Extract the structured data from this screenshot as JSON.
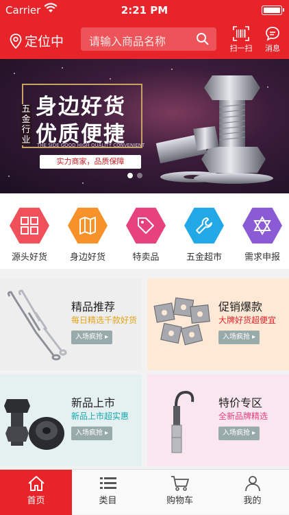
{
  "status": {
    "carrier": "Carrier",
    "time": "2:21 PM"
  },
  "navbar": {
    "location": "定位中",
    "search_placeholder": "请输入商品名称",
    "scan_label": "扫一扫",
    "message_label": "消息"
  },
  "banner": {
    "vertical_text": "五金行业",
    "line1": "身边好货",
    "line2": "优质便捷",
    "english": "THE SIDE GOOD HIGH QUALITY CONVENIENT",
    "slogan": "实力商家，品质保障"
  },
  "categories": [
    {
      "label": "源头好货",
      "icon": "grid-icon",
      "color": "#f0505a"
    },
    {
      "label": "身边好货",
      "icon": "map-icon",
      "color": "#f7922b"
    },
    {
      "label": "特卖品",
      "icon": "tag-icon",
      "color": "#e8427e"
    },
    {
      "label": "五金超市",
      "icon": "wrench-icon",
      "color": "#22a8e6"
    },
    {
      "label": "需求申报",
      "icon": "star-of-david-icon",
      "color": "#8b5bd6"
    }
  ],
  "promos": [
    {
      "title": "精品推荐",
      "subtitle": "每日精选千款好货",
      "button": "入场疯抢",
      "subtitle_color": "#e6a21b",
      "bg": "#eeeeee"
    },
    {
      "title": "促销爆款",
      "subtitle": "大牌好货超便宜",
      "button": "入场疯抢",
      "subtitle_color": "#e8242b",
      "bg": "#fde9d6"
    },
    {
      "title": "新品上市",
      "subtitle": "新品上市超实惠",
      "button": "入场疯抢",
      "subtitle_color": "#1aa6b0",
      "bg": "#e4f1f0"
    },
    {
      "title": "特价专区",
      "subtitle": "全新品牌精选",
      "button": "入场疯抢",
      "subtitle_color": "#e8427e",
      "bg": "#f9e6ee"
    }
  ],
  "tabs": [
    {
      "label": "首页",
      "icon": "home-icon",
      "active": true
    },
    {
      "label": "类目",
      "icon": "list-icon",
      "active": false
    },
    {
      "label": "购物车",
      "icon": "cart-icon",
      "active": false
    },
    {
      "label": "我的",
      "icon": "user-icon",
      "active": false
    }
  ]
}
